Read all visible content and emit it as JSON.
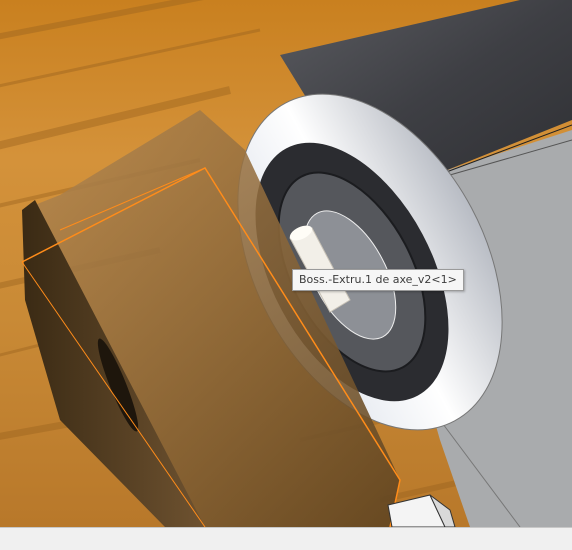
{
  "viewport": {
    "tooltip": "Boss.-Extru.1 de axe_v2<1>"
  },
  "status_bar": {
    "text": ""
  },
  "colors": {
    "wood": "#c98a36",
    "selection_edge": "#ff8c1a",
    "shaft_dark": "#4a4b4f",
    "disc_light": "#e8ecf2",
    "panel_grey": "#a9abad"
  }
}
